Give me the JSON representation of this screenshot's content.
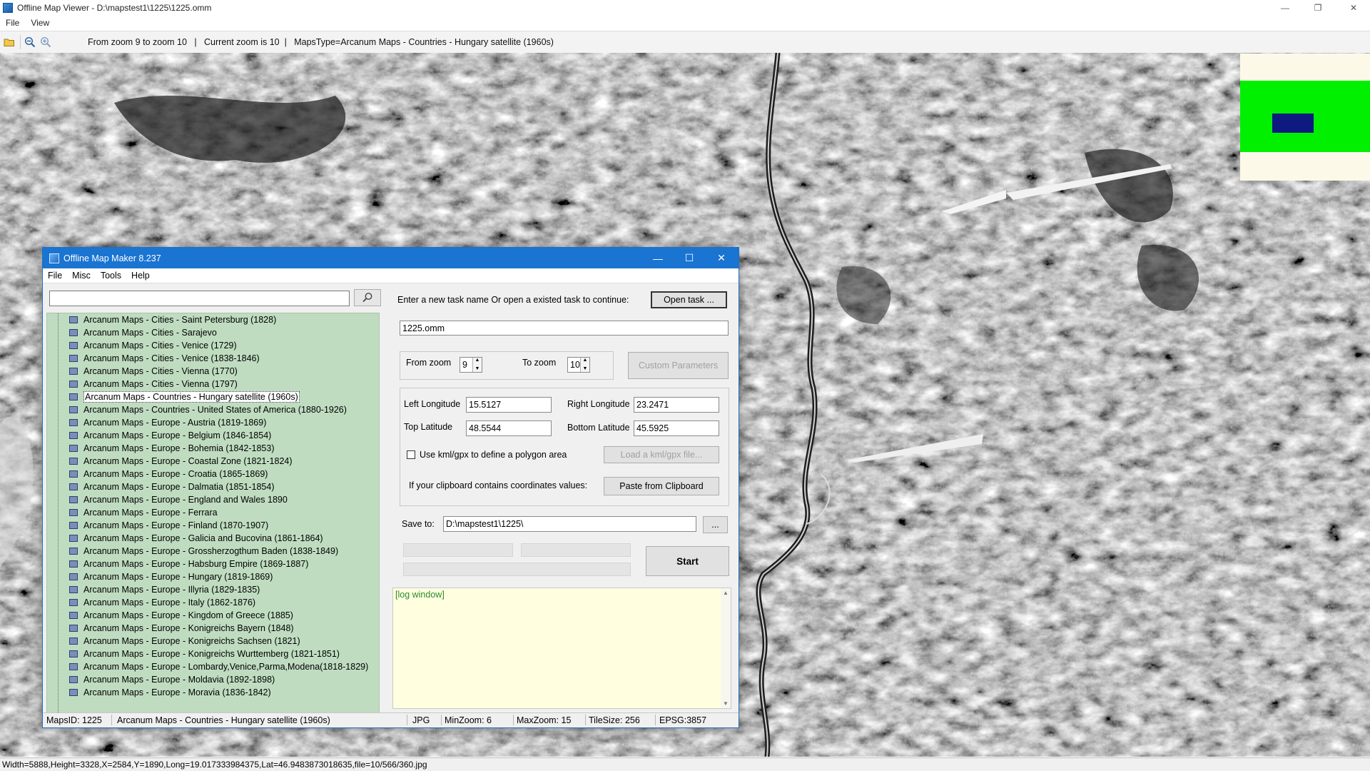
{
  "viewer": {
    "title": "Offline Map Viewer - D:\\mapstest1\\1225\\1225.omm",
    "menu": [
      "File",
      "View"
    ],
    "zoom_info": "From zoom 9 to zoom 10   |   Current zoom is 10  |   MapsType=Arcanum Maps - Countries - Hungary satellite (1960s)",
    "status": "Width=5888,Height=3328,X=2584,Y=1890,Long=19.017333984375,Lat=46.9483873018635,file=10/566/360.jpg",
    "toolbar_icons": [
      "open-folder-icon",
      "zoom-out-icon",
      "zoom-in-icon"
    ],
    "minimap_colors": {
      "background": "#fdf9e9",
      "area": "#00f000",
      "view": "#0e1a80"
    }
  },
  "dialog": {
    "title": "Offline Map Maker 8.237",
    "menu": [
      "File",
      "Misc",
      "Tools",
      "Help"
    ],
    "search_value": "",
    "maps": [
      "Arcanum Maps - Cities - Saint Petersburg (1828)",
      "Arcanum Maps - Cities - Sarajevo",
      "Arcanum Maps - Cities - Venice (1729)",
      "Arcanum Maps - Cities - Venice (1838-1846)",
      "Arcanum Maps - Cities - Vienna (1770)",
      "Arcanum Maps - Cities - Vienna (1797)",
      "Arcanum Maps - Countries - Hungary satellite (1960s)",
      "Arcanum Maps - Countries - United States of America (1880-1926)",
      "Arcanum Maps - Europe - Austria (1819-1869)",
      "Arcanum Maps - Europe - Belgium (1846-1854)",
      "Arcanum Maps - Europe - Bohemia (1842-1853)",
      "Arcanum Maps - Europe - Coastal Zone (1821-1824)",
      "Arcanum Maps - Europe - Croatia (1865-1869)",
      "Arcanum Maps - Europe - Dalmatia (1851-1854)",
      "Arcanum Maps - Europe - England and Wales 1890",
      "Arcanum Maps - Europe - Ferrara",
      "Arcanum Maps - Europe - Finland (1870-1907)",
      "Arcanum Maps - Europe - Galicia and Bucovina (1861-1864)",
      "Arcanum Maps - Europe - Grossherzogthum Baden (1838-1849)",
      "Arcanum Maps - Europe - Habsburg Empire (1869-1887)",
      "Arcanum Maps - Europe - Hungary (1819-1869)",
      "Arcanum Maps - Europe - Illyria (1829-1835)",
      "Arcanum Maps - Europe - Italy (1862-1876)",
      "Arcanum Maps - Europe - Kingdom of Greece (1885)",
      "Arcanum Maps - Europe - Konigreichs Bayern (1848)",
      "Arcanum Maps - Europe - Konigreichs Sachsen (1821)",
      "Arcanum Maps - Europe - Konigreichs Wurttemberg (1821-1851)",
      "Arcanum Maps - Europe - Lombardy,Venice,Parma,Modena(1818-1829)",
      "Arcanum Maps - Europe - Moldavia (1892-1898)",
      "Arcanum Maps - Europe - Moravia (1836-1842)"
    ],
    "selected_map": "Arcanum Maps - Countries - Hungary satellite (1960s)",
    "task_prompt": "Enter a new task name Or open a existed task to continue:",
    "open_task_label": "Open task ...",
    "task_name": "1225.omm",
    "from_zoom_label": "From zoom",
    "from_zoom": "9",
    "to_zoom_label": "To zoom",
    "to_zoom": "10",
    "custom_params_label": "Custom Parameters",
    "left_lon_label": "Left Longitude",
    "left_lon": "15.5127",
    "right_lon_label": "Right Longitude",
    "right_lon": "23.2471",
    "top_lat_label": "Top Latitude",
    "top_lat": "48.5544",
    "bottom_lat_label": "Bottom Latitude",
    "bottom_lat": "45.5925",
    "kml_label": "Use kml/gpx to define a polygon area",
    "load_kml_label": "Load a kml/gpx file...",
    "clipboard_label": "If your clipboard contains coordinates values:",
    "paste_label": "Paste from Clipboard",
    "save_to_label": "Save to:",
    "save_to": "D:\\mapstest1\\1225\\",
    "browse_label": "...",
    "start_label": "Start",
    "log_text": "[log window]",
    "status": {
      "maps_id": "MapsID: 1225",
      "map_name": "Arcanum Maps - Countries - Hungary satellite (1960s)",
      "format": "JPG",
      "min_zoom": "MinZoom: 6",
      "max_zoom": "MaxZoom: 15",
      "tile_size": "TileSize: 256",
      "epsg": "EPSG:3857"
    }
  }
}
